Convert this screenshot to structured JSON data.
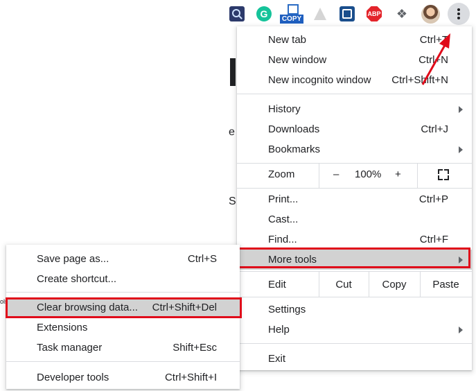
{
  "toolbar": {
    "grammarly_letter": "G",
    "copy_label": "COPY",
    "abp_label": "ABP"
  },
  "page_behind": {
    "chars": [
      "e",
      "S",
      "ols"
    ]
  },
  "main_menu": {
    "new_tab": {
      "label": "New tab",
      "shortcut": "Ctrl+T"
    },
    "new_window": {
      "label": "New window",
      "shortcut": "Ctrl+N"
    },
    "new_incognito": {
      "label": "New incognito window",
      "shortcut": "Ctrl+Shift+N"
    },
    "history": {
      "label": "History"
    },
    "downloads": {
      "label": "Downloads",
      "shortcut": "Ctrl+J"
    },
    "bookmarks": {
      "label": "Bookmarks"
    },
    "zoom": {
      "label": "Zoom",
      "minus": "–",
      "level": "100%",
      "plus": "+"
    },
    "print": {
      "label": "Print...",
      "shortcut": "Ctrl+P"
    },
    "cast": {
      "label": "Cast..."
    },
    "find": {
      "label": "Find...",
      "shortcut": "Ctrl+F"
    },
    "more_tools": {
      "label": "More tools"
    },
    "edit": {
      "label": "Edit",
      "cut": "Cut",
      "copy": "Copy",
      "paste": "Paste"
    },
    "settings": {
      "label": "Settings"
    },
    "help": {
      "label": "Help"
    },
    "exit": {
      "label": "Exit"
    }
  },
  "sub_menu": {
    "save_page": {
      "label": "Save page as...",
      "shortcut": "Ctrl+S"
    },
    "create_shortcut": {
      "label": "Create shortcut..."
    },
    "clear_browsing": {
      "label": "Clear browsing data...",
      "shortcut": "Ctrl+Shift+Del"
    },
    "extensions": {
      "label": "Extensions"
    },
    "task_manager": {
      "label": "Task manager",
      "shortcut": "Shift+Esc"
    },
    "developer_tools": {
      "label": "Developer tools",
      "shortcut": "Ctrl+Shift+I"
    }
  },
  "colors": {
    "highlight_border": "#e00b1a",
    "selected_row": "#d2d2d2",
    "arrow": "#e00b1a"
  }
}
